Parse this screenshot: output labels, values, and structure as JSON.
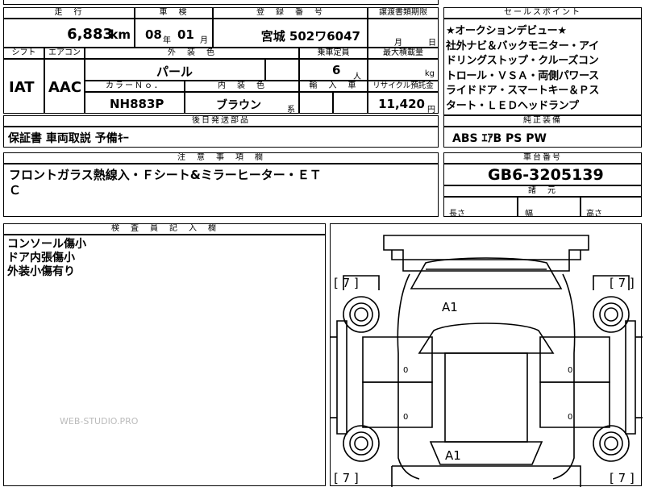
{
  "mileage": {
    "header": "走　行",
    "value": "6,883",
    "unit": "km"
  },
  "inspection": {
    "header": "車　検",
    "year": "08",
    "year_unit": "年",
    "month": "01",
    "month_unit": "月"
  },
  "registration": {
    "header": "登　録　番　号",
    "value": "宮城 502ワ6047"
  },
  "transfer": {
    "header": "譲渡書類期限",
    "month_unit": "月",
    "day_unit": "日"
  },
  "selling_points": {
    "header": "セールスポイント",
    "lines": [
      "★オークションデビュー★",
      "社外ナビ＆バックモニター・アイ",
      "ドリングストップ・クルーズコン",
      "トロール・ＶＳＡ・両側パワース",
      "ライドドア・スマートキー＆Ｐス",
      "タート・ＬＥＤヘッドランプ"
    ]
  },
  "shift": {
    "header": "シフト",
    "value": "IAT"
  },
  "aircon": {
    "header": "エアコン",
    "value": "AAC"
  },
  "exterior_color": {
    "header": "外　装　色",
    "value": "パール"
  },
  "capacity": {
    "header": "乗車定員",
    "value": "6",
    "unit": "人"
  },
  "max_load": {
    "header": "最大積載量",
    "unit": "kg"
  },
  "color_no": {
    "header": "カラーＮｏ．",
    "value": "NH883P"
  },
  "interior_color": {
    "header": "内　装　色",
    "value": "ブラウン",
    "unit": "系"
  },
  "import": {
    "header": "輸　入　車"
  },
  "recycle": {
    "header": "リサイクル預託金",
    "value": "11,420",
    "unit": "円"
  },
  "later_parts": {
    "header": "後日発送部品",
    "value": "保証書 車両取説 予備ｷｰ"
  },
  "genuine_equipment": {
    "header": "純正装備",
    "value": "ABS ｴｱB PS PW"
  },
  "notes": {
    "header": "注　意　事　項　欄",
    "lines": [
      "フロントガラス熱線入・Ｆシート&ミラーヒーター・ＥＴ",
      "Ｃ"
    ]
  },
  "chassis": {
    "header": "車台番号",
    "value": "GB6-3205139"
  },
  "dimensions": {
    "header": "諸　元",
    "length": "長さ",
    "width": "幅",
    "height": "高さ"
  },
  "inspector": {
    "header": "検　査　員　記　入　欄",
    "lines": [
      "コンソール傷小",
      "ドア内張傷小",
      "外装小傷有り"
    ]
  },
  "watermark": "WEB-STUDIO.PRO",
  "diagram": {
    "tire_labels": [
      "[ 7 ]",
      "[ 7 ]",
      "[ 7 ]",
      "[ 7 ]"
    ],
    "damage_front": "A1",
    "damage_rear": "A1",
    "seat_marks": [
      "0",
      "0",
      "0",
      "0"
    ]
  }
}
